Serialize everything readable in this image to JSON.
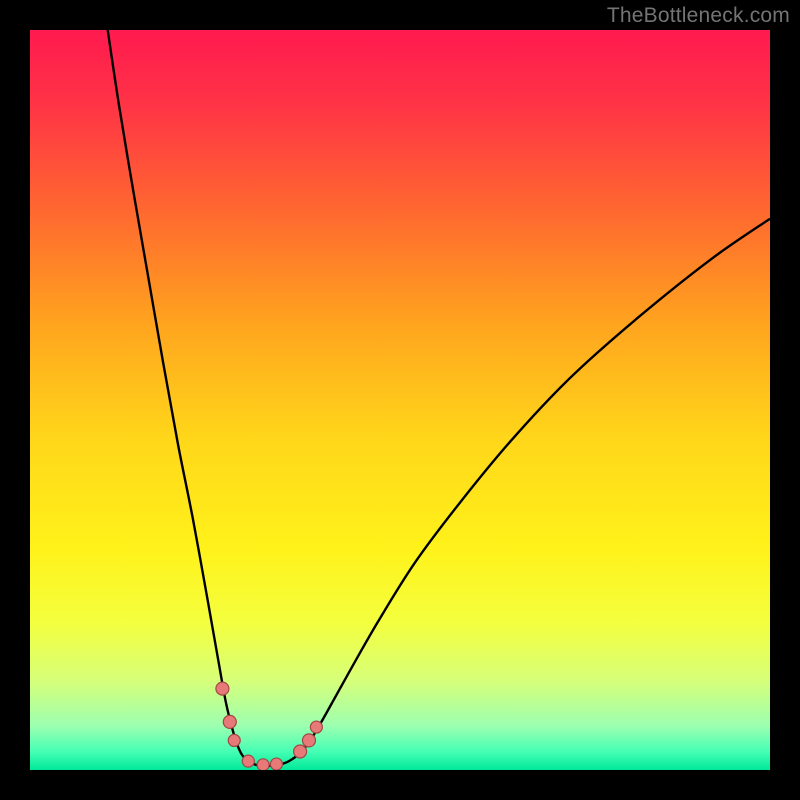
{
  "watermark": "TheBottleneck.com",
  "colors": {
    "frame": "#000000",
    "curve": "#000000",
    "marker_fill": "#e77a78",
    "marker_stroke": "#a24746",
    "gradient_stops": [
      {
        "offset": 0.0,
        "color": "#ff1a4f"
      },
      {
        "offset": 0.1,
        "color": "#ff3346"
      },
      {
        "offset": 0.25,
        "color": "#ff6a2f"
      },
      {
        "offset": 0.4,
        "color": "#ffa51e"
      },
      {
        "offset": 0.55,
        "color": "#ffd61a"
      },
      {
        "offset": 0.7,
        "color": "#fff21a"
      },
      {
        "offset": 0.8,
        "color": "#f4ff3e"
      },
      {
        "offset": 0.88,
        "color": "#d6ff7a"
      },
      {
        "offset": 0.94,
        "color": "#9dffb0"
      },
      {
        "offset": 0.975,
        "color": "#46ffb4"
      },
      {
        "offset": 1.0,
        "color": "#00e89a"
      }
    ]
  },
  "chart_data": {
    "type": "line",
    "title": "",
    "xlabel": "",
    "ylabel": "",
    "xlim": [
      0,
      100
    ],
    "ylim": [
      0,
      100
    ],
    "series": [
      {
        "name": "curve",
        "x": [
          10.5,
          12,
          14,
          16,
          18,
          20,
          22,
          24,
          25.5,
          26.5,
          27.5,
          28.3,
          29,
          30,
          31,
          32,
          33,
          34,
          35,
          36.5,
          38,
          40,
          43,
          47,
          52,
          58,
          65,
          73,
          82,
          92,
          100
        ],
        "y": [
          100,
          90,
          78,
          66.5,
          55,
          44,
          34,
          23,
          14.5,
          9,
          5,
          2.7,
          1.6,
          0.9,
          0.6,
          0.55,
          0.6,
          0.8,
          1.2,
          2.3,
          4.2,
          7.6,
          13,
          20,
          28,
          36,
          44.5,
          53,
          61,
          69,
          74.5
        ]
      }
    ],
    "markers": [
      {
        "x": 26.0,
        "y": 11.0,
        "r": 6.5
      },
      {
        "x": 27.0,
        "y": 6.5,
        "r": 6.5
      },
      {
        "x": 27.6,
        "y": 4.0,
        "r": 6.0
      },
      {
        "x": 29.5,
        "y": 1.2,
        "r": 6.0
      },
      {
        "x": 31.5,
        "y": 0.7,
        "r": 6.0
      },
      {
        "x": 33.3,
        "y": 0.8,
        "r": 6.0
      },
      {
        "x": 36.5,
        "y": 2.5,
        "r": 6.5
      },
      {
        "x": 37.7,
        "y": 4.0,
        "r": 6.5
      },
      {
        "x": 38.7,
        "y": 5.8,
        "r": 6.0
      }
    ]
  }
}
